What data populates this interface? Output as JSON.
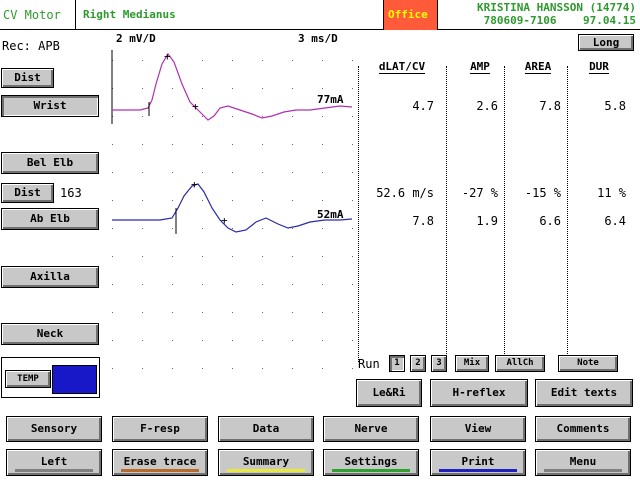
{
  "header": {
    "app": "CV Motor",
    "nerve": "Right Medianus",
    "office": "Office",
    "patient_name": "KRISTINA HANSSON (14774)",
    "patient_id": "780609-7106",
    "date": "97.04.15"
  },
  "recording": {
    "site_label": "Rec: APB",
    "sensitivity": "2 mV/D",
    "sweep": "3 ms/D",
    "long_button": "Long"
  },
  "sites": {
    "dist_button_1": "Dist",
    "wrist": "Wrist",
    "bel_elb": "Bel Elb",
    "dist_button_2": "Dist",
    "distance_value": "163",
    "ab_elb": "Ab Elb",
    "axilla": "Axilla",
    "neck": "Neck",
    "temp_button": "TEMP"
  },
  "traces": {
    "trace1_ma": "77mA",
    "trace2_ma": "52mA",
    "trace1_color": "#b030b0",
    "trace2_color": "#2a2aa8"
  },
  "table": {
    "headers": [
      "dLAT/CV",
      "AMP",
      "AREA",
      "DUR"
    ],
    "row1": [
      "4.7",
      "2.6",
      "7.8",
      "5.8"
    ],
    "row2": [
      "52.6 m/s",
      "-27 %",
      "-15 %",
      "11 %"
    ],
    "row3": [
      "7.8",
      "1.9",
      "6.6",
      "6.4"
    ]
  },
  "run": {
    "label": "Run",
    "buttons": [
      "1",
      "2",
      "3",
      "Mix",
      "AllCh"
    ],
    "note": "Note"
  },
  "actions": {
    "le_ri": "Le&Ri",
    "h_reflex": "H-reflex",
    "edit_texts": "Edit texts"
  },
  "menu_row1": [
    "Sensory",
    "F-resp",
    "Data",
    "Nerve",
    "View",
    "Comments"
  ],
  "menu_row2": [
    "Left",
    "Erase trace",
    "Summary",
    "Settings",
    "Print",
    "Menu"
  ],
  "menu_row2_colors": [
    "#808080",
    "#b86a2a",
    "#e8e840",
    "#30a030",
    "#2020c0",
    "#808080"
  ],
  "temp_color": "#1818c8"
}
